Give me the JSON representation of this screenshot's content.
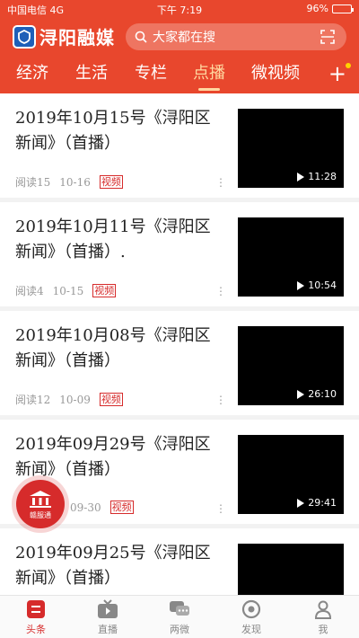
{
  "status": {
    "carrier": "中国电信  4G",
    "time": "下午 7:19",
    "battery": "96%",
    "battery_level": 0.96
  },
  "header": {
    "app_name": "浔阳融媒",
    "search_placeholder": "大家都在搜"
  },
  "tabs": [
    {
      "label": "经济"
    },
    {
      "label": "生活"
    },
    {
      "label": "专栏"
    },
    {
      "label": "点播",
      "active": true
    },
    {
      "label": "微视频"
    }
  ],
  "feed": [
    {
      "title": "2019年10月15号《浔阳区新闻》（首播）",
      "reads": "阅读15",
      "date": "10-16",
      "tag": "视频",
      "duration": "11:28"
    },
    {
      "title": "2019年10月11号《浔阳区新闻》（首播）.",
      "reads": "阅读4",
      "date": "10-15",
      "tag": "视频",
      "duration": "10:54"
    },
    {
      "title": "2019年10月08号《浔阳区新闻》（首播）",
      "reads": "阅读12",
      "date": "10-09",
      "tag": "视频",
      "duration": "26:10"
    },
    {
      "title": "2019年09月29号《浔阳区新闻》（首播）",
      "reads": "",
      "date": "09-30",
      "tag": "视频",
      "duration": "29:41"
    },
    {
      "title": "2019年09月25号《浔阳区新闻》（首播）",
      "reads": "",
      "date": "",
      "tag": "",
      "duration": ""
    }
  ],
  "floating_badge": {
    "label": "赣服通"
  },
  "bottom_nav": [
    {
      "label": "头条",
      "active": true
    },
    {
      "label": "直播"
    },
    {
      "label": "两微"
    },
    {
      "label": "发现"
    },
    {
      "label": "我"
    }
  ],
  "colors": {
    "brand": "#e8472d",
    "active_tab": "#ffd7a0",
    "tag_red": "#d62b2b"
  }
}
